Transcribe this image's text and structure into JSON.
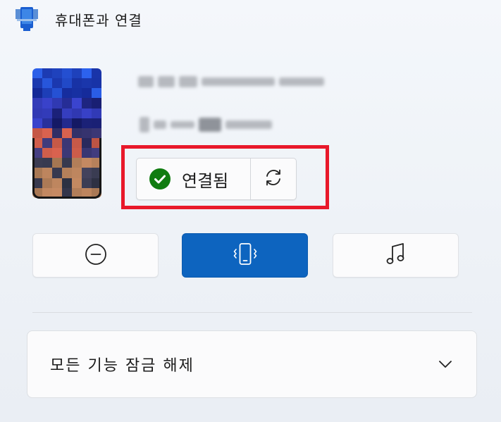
{
  "app": {
    "title": "휴대폰과 연결",
    "icon": "phone-link-app-icon"
  },
  "device": {
    "image_icon": "phone-thumbnail",
    "status_label": "연결됨",
    "status_icon": "check-circle-icon",
    "refresh_icon": "refresh-icon"
  },
  "actions": [
    {
      "name": "do-not-disturb",
      "icon": "minus-circle-icon",
      "active": false
    },
    {
      "name": "vibrate",
      "icon": "phone-vibrate-icon",
      "active": true
    },
    {
      "name": "media",
      "icon": "music-note-icon",
      "active": false
    }
  ],
  "expander": {
    "label": "모든 기능 잠금 해제",
    "icon": "chevron-down-icon"
  },
  "colors": {
    "accent": "#0d64bf",
    "success": "#107c10",
    "highlight": "#e8182a"
  }
}
